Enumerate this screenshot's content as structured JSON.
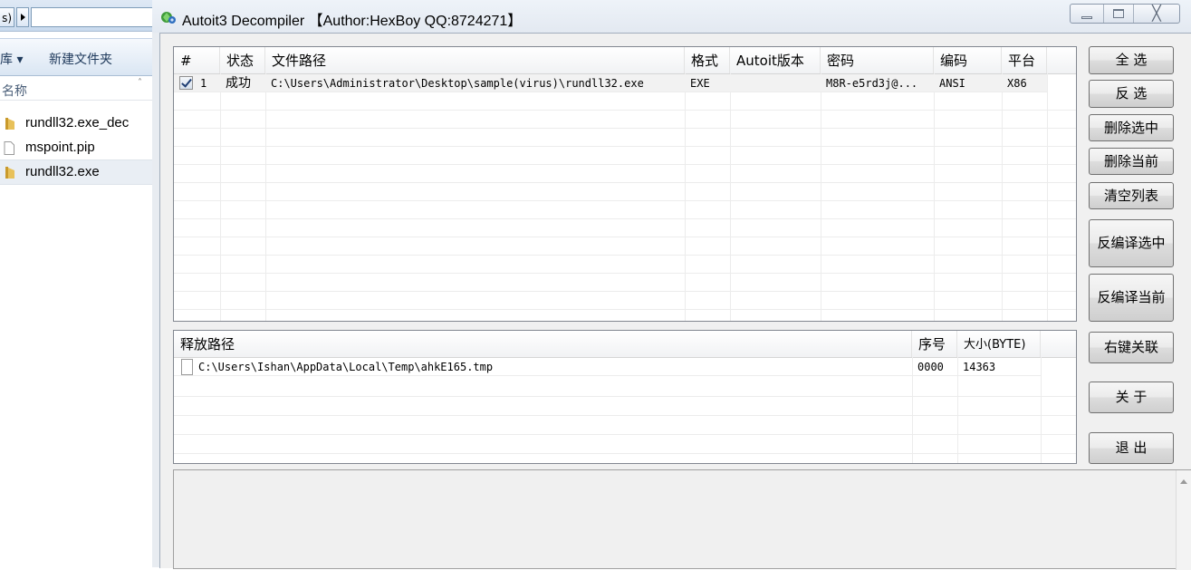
{
  "explorer": {
    "crumb": "s)",
    "toolbar": {
      "organize": "库 ▾",
      "new_folder": "新建文件夹"
    },
    "column_name": "名称",
    "sort_glyph": "˄",
    "files": [
      {
        "name": "rundll32.exe_dec",
        "icon": "folder-icon"
      },
      {
        "name": "mspoint.pip",
        "icon": "document-icon"
      },
      {
        "name": "rundll32.exe",
        "icon": "folder-icon",
        "selected": true
      }
    ]
  },
  "window": {
    "title": "Autoit3 Decompiler 【Author:HexBoy  QQ:8724271】",
    "close_glyph": "╳"
  },
  "file_list": {
    "columns": [
      "#",
      "状态",
      "文件路径",
      "格式",
      "Autoit版本",
      "密码",
      "编码",
      "平台"
    ],
    "rows": [
      {
        "checked": true,
        "index": "1",
        "status": "成功",
        "path": "C:\\Users\\Administrator\\Desktop\\sample(virus)\\rundll32.exe",
        "format": "EXE",
        "version": "",
        "password": "M8R-e5rd3j@...",
        "encoding": "ANSI",
        "platform": "X86"
      }
    ]
  },
  "release_list": {
    "columns": [
      "释放路径",
      "序号",
      "大小(BYTE)"
    ],
    "rows": [
      {
        "path": "C:\\Users\\Ishan\\AppData\\Local\\Temp\\ahkE165.tmp",
        "seq": "0000",
        "size": "14363"
      }
    ]
  },
  "buttons": {
    "select_all": "全  选",
    "invert": "反  选",
    "delete_selected": "删除选中",
    "delete_current": "删除当前",
    "clear_list": "清空列表",
    "decompile_selected": "反编译选中",
    "decompile_current": "反编译当前",
    "context_menu": "右键关联",
    "about": "关  于",
    "exit": "退  出"
  },
  "colors": {
    "title_bg": "#e3e9f1",
    "frame_bg": "#f0f0f0",
    "row_filled": "#f2f2f2",
    "folder": "#e8c15a"
  }
}
